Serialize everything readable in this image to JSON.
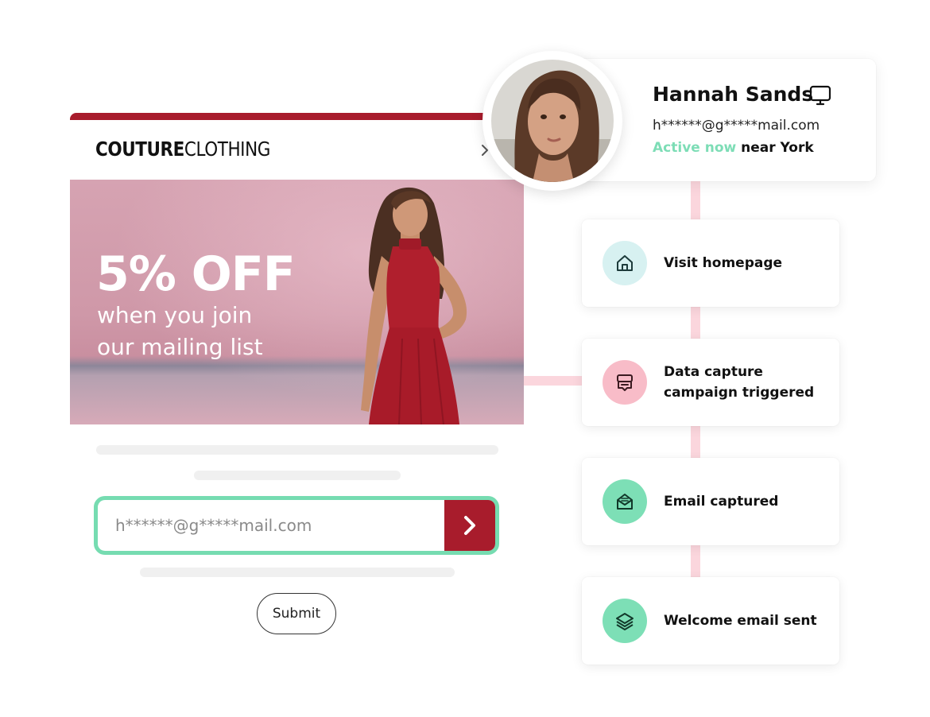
{
  "brand": {
    "logo_bold": "COUTURE",
    "logo_light": "CLOTHING",
    "accent_color": "#a81c2c"
  },
  "hero": {
    "headline": "5% OFF",
    "subline_1": "when you join",
    "subline_2": "our mailing list",
    "image": "model-in-red-dress"
  },
  "signup_form": {
    "email_placeholder": "h******@g*****mail.com",
    "go_icon": "chevron-right-icon",
    "submit_label": "Submit",
    "border_color": "#76dcb1"
  },
  "profile": {
    "name": "Hannah Sands",
    "device_icon": "desktop-icon",
    "email": "h******@g*****mail.com",
    "status_active": "Active now",
    "status_location": "near York",
    "active_color": "#7dddb6"
  },
  "journey": {
    "connector_color": "#fbd6dd",
    "steps": [
      {
        "label": "Visit homepage",
        "icon": "home-icon",
        "icon_bg": "#d7f1f1"
      },
      {
        "label_line1": "Data capture",
        "label_line2": "campaign triggered",
        "icon": "popup-message-icon",
        "icon_bg": "#f8bcc8"
      },
      {
        "label": "Email captured",
        "icon": "envelope-open-icon",
        "icon_bg": "#7ddfb6"
      },
      {
        "label": "Welcome email sent",
        "icon": "stack-layers-icon",
        "icon_bg": "#7ddfb6"
      }
    ]
  }
}
